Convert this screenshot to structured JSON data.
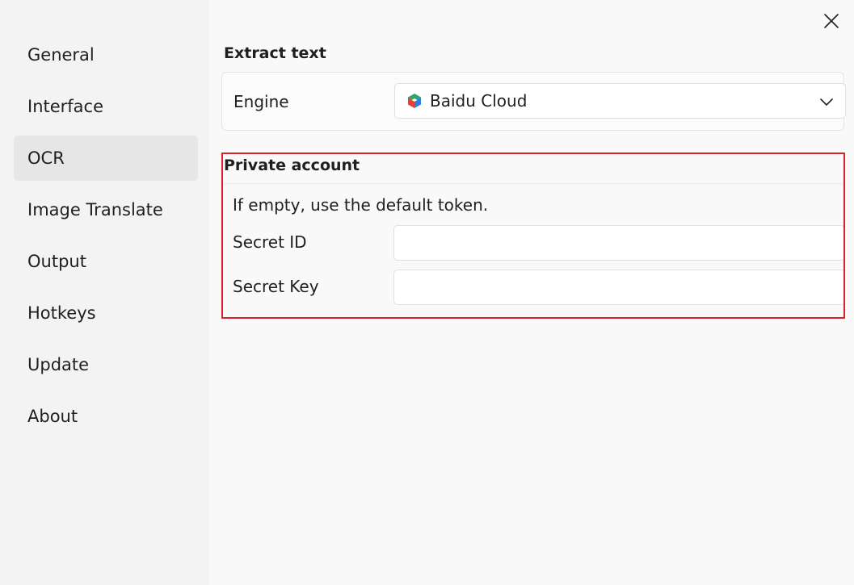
{
  "sidebar": {
    "items": [
      {
        "label": "General"
      },
      {
        "label": "Interface"
      },
      {
        "label": "OCR"
      },
      {
        "label": "Image Translate"
      },
      {
        "label": "Output"
      },
      {
        "label": "Hotkeys"
      },
      {
        "label": "Update"
      },
      {
        "label": "About"
      }
    ],
    "active": "OCR"
  },
  "extract": {
    "title": "Extract text",
    "engine_label": "Engine",
    "engine_value": "Baidu Cloud",
    "engine_icon": "baidu-cloud-logo"
  },
  "account": {
    "title": "Private account",
    "hint": "If empty, use the default token.",
    "secret_id_label": "Secret ID",
    "secret_id_value": "",
    "secret_key_label": "Secret Key",
    "secret_key_value": ""
  },
  "colors": {
    "highlight": "#d9202a",
    "sidebar_bg": "#f3f3f3",
    "active_bg": "#e6e6e6"
  },
  "icons": {
    "close": "close-icon",
    "chevron": "chevron-down-icon"
  }
}
